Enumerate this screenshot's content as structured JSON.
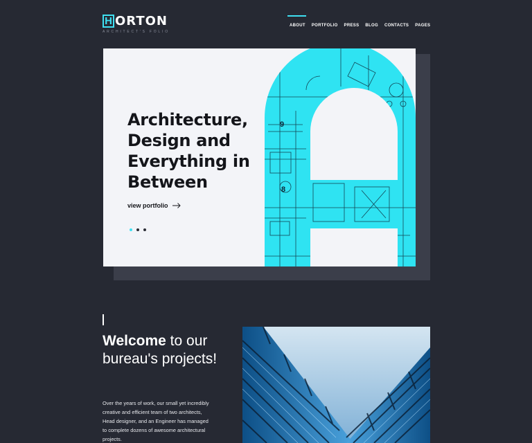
{
  "brand": {
    "letter": "H",
    "name": "ORTON",
    "tagline": "Architect's Folio",
    "accent": "#3ee0f2"
  },
  "nav": {
    "items": [
      "ABOUT",
      "PORTFOLIO",
      "PRESS",
      "BLOG",
      "CONTACTS",
      "PAGES"
    ],
    "active": "ABOUT"
  },
  "hero": {
    "title": "Architecture, Design and Everything in Between",
    "link_label": "view portfolio",
    "slides": 3,
    "active_slide": 1,
    "plan_numbers": [
      "9",
      "8"
    ]
  },
  "welcome": {
    "title_bold": "Welcome",
    "title_rest": " to our bureau's projects!",
    "description": "Over the years of work, our small yet incredibly creative and efficient team of two architects, Head designer, and an Engineer has managed to complete dozens of awesome architectural projects."
  },
  "colors": {
    "background": "#262933",
    "hero_bg": "#f3f4f8",
    "accent": "#3ee0f2"
  }
}
